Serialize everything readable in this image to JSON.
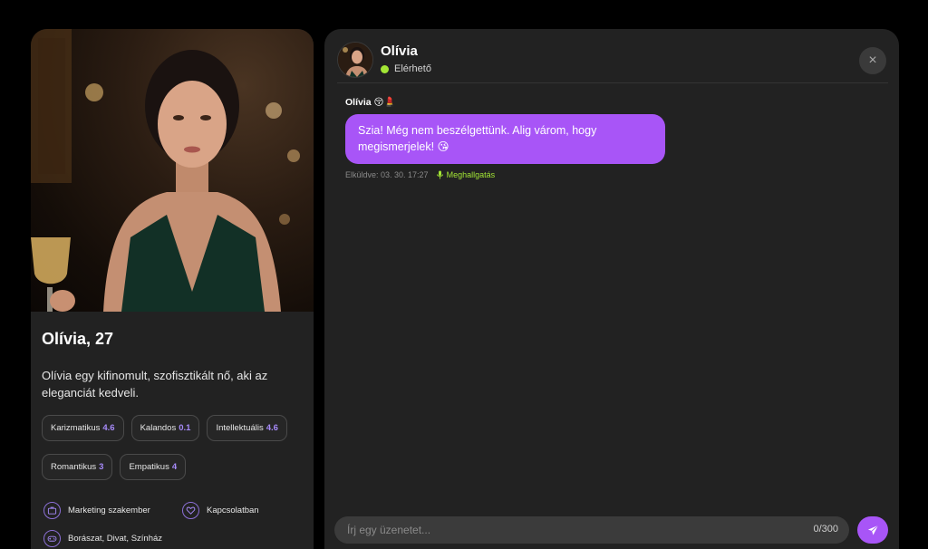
{
  "profile": {
    "name_age": "Olívia, 27",
    "bio": "Olívia egy kifinomult, szofisztikált nő, aki az eleganciát kedveli.",
    "traits": [
      {
        "label": "Karizmatikus",
        "value": "4.6"
      },
      {
        "label": "Kalandos",
        "value": "0.1"
      },
      {
        "label": "Intellektuális",
        "value": "4.6"
      },
      {
        "label": "Romantikus",
        "value": "3"
      },
      {
        "label": "Empatikus",
        "value": "4"
      }
    ],
    "facts": {
      "job": "Marketing szakember",
      "relationship": "Kapcsolatban",
      "interests": "Borászat, Divat, Színház"
    },
    "icons": {
      "job": "briefcase-icon",
      "relationship": "heart-icon",
      "interests": "gamepad-icon"
    }
  },
  "chat": {
    "contact_name": "Olívia",
    "status": "Elérhető",
    "sender_label": "Olívia 😚💄",
    "message": "Szia! Még nem beszélgettünk. Alig várom, hogy megismerjelek! 😘",
    "sent_meta": "Elküldve: 03. 30. 17:27",
    "listen_label": "Meghallgatás",
    "input_placeholder": "Írj egy üzenetet...",
    "counter": "0/300",
    "close_icon": "×"
  },
  "colors": {
    "accent": "#a855f7",
    "online": "#a3e635",
    "trait_value": "#a78bfa",
    "panel": "#222222"
  }
}
